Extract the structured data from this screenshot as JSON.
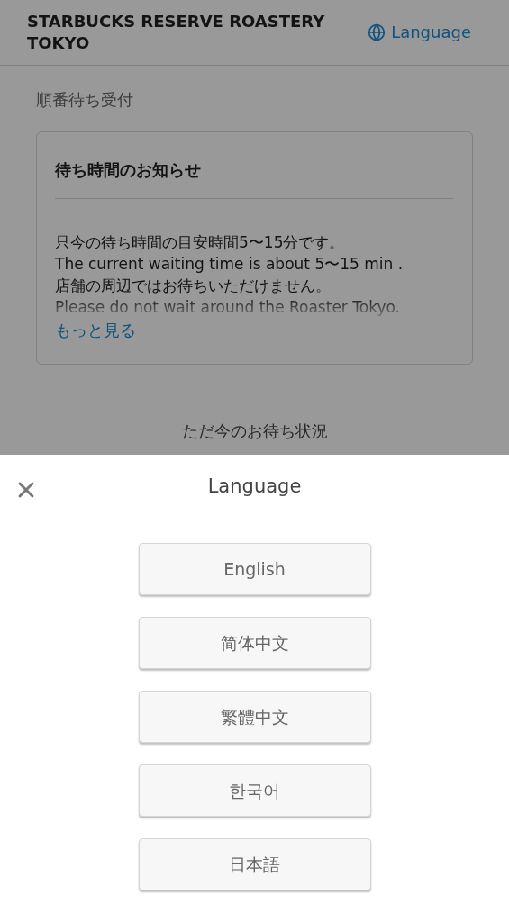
{
  "header": {
    "title": "STARBUCKS RESERVE ROASTERY TOKYO",
    "language_link": "Language"
  },
  "page_heading": "順番待ち受付",
  "notice": {
    "title": "待ち時間のお知らせ",
    "lines": [
      "只今の待ち時間の目安時間5〜15分です。",
      "The current waiting time is about 5〜15 min .",
      "店舗の周辺ではお待ちいただけません。",
      "Please do not wait around the Roaster Tokyo."
    ],
    "more_link": "もっと見る"
  },
  "status_heading": "ただ今のお待ち状況",
  "language_sheet": {
    "title": "Language",
    "options": [
      "English",
      "简体中文",
      "繁體中文",
      "한국어",
      "日本語"
    ]
  }
}
